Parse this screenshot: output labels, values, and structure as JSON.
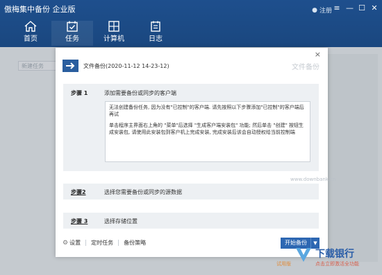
{
  "app": {
    "title": "傲梅集中备份 企业版"
  },
  "header": {
    "user_label": "注册",
    "window_controls": [
      "≡",
      "—",
      "☐",
      "✕"
    ],
    "nav": [
      {
        "label": "首页",
        "icon": "home-icon"
      },
      {
        "label": "任务",
        "icon": "calendar-check-icon"
      },
      {
        "label": "计算机",
        "icon": "windows-icon"
      },
      {
        "label": "日志",
        "icon": "log-icon"
      }
    ]
  },
  "background": {
    "new_task_placeholder": "新建任务"
  },
  "dialog": {
    "title": "文件备份(2020-11-12 14-23-12)",
    "type_label": "文件备份",
    "close": "×",
    "steps": [
      {
        "num": "步骤 1",
        "desc": "添加需要备份或同步的客户端"
      },
      {
        "num": "步骤2",
        "desc": "选择您需要备份或同步的源数据"
      },
      {
        "num": "步骤 3",
        "desc": "选择存储位置"
      }
    ],
    "step1_text": {
      "para1": "无法创建备份任务, 因为没有\"已控制\"的客户端. 请先按照以下步骤添加\"已控制\"的客户端后再试",
      "para2": "单击程序主界面右上角的 \"菜单\"后选择 \"生成客户端安装包\" 功能; 然后单击 \"创建\" 按钮生成安装包, 请使用此安装包到客户机上完成安装, 完成安装后该会自动授权给当前控制端"
    },
    "footer": {
      "settings": "设置",
      "schedule": "定时任务",
      "strategy": "备份策略"
    },
    "start_button": "开始备份"
  },
  "watermark": {
    "brand": "下载银行",
    "line1": "试用版",
    "line2": "点击立即激活全功能",
    "url": "www.downbank.cn"
  },
  "colors": {
    "header": "#1e4f8d",
    "accent": "#2d67b2"
  }
}
